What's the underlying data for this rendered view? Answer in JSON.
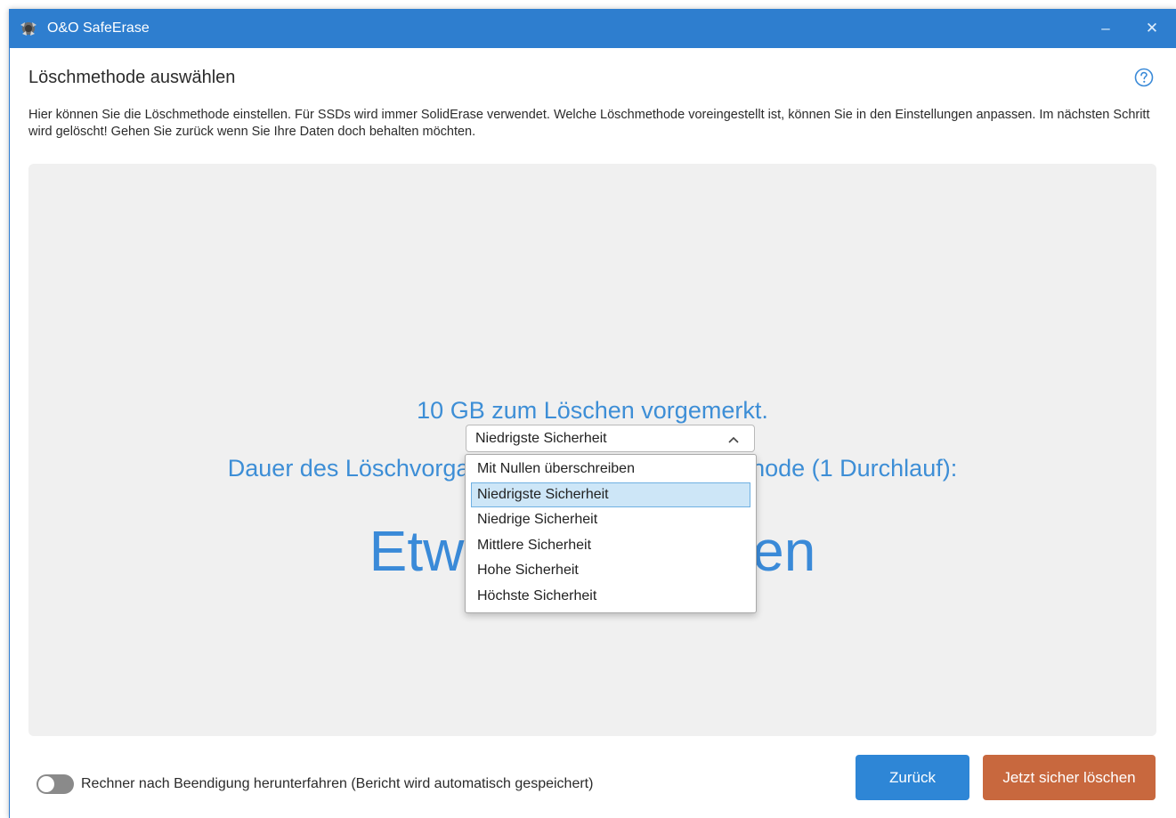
{
  "window": {
    "title": "O&O SafeErase",
    "minimize_glyph": "–",
    "close_glyph": "✕"
  },
  "page": {
    "title": "Löschmethode auswählen",
    "help_icon": "question-circle-icon",
    "description": "Hier können Sie die Löschmethode einstellen. Für SSDs wird immer SolidErase verwendet. Welche Löschmethode voreingestellt ist, können Sie in den Einstellungen anpassen. Im nächsten Schritt wird gelöscht! Gehen Sie zurück wenn Sie Ihre Daten doch behalten möchten."
  },
  "method_select": {
    "selected": "Niedrigste Sicherheit",
    "options": [
      "Mit Nullen überschreiben",
      "Niedrigste Sicherheit",
      "Niedrige Sicherheit",
      "Mittlere Sicherheit",
      "Hohe Sicherheit",
      "Höchste Sicherheit"
    ],
    "highlighted_index": 1
  },
  "summary": {
    "line1": "10 GB zum Löschen vorgemerkt.",
    "line2": "Dauer des Löschvorgangs mit der gewählten Methode (1 Durchlauf):",
    "duration": "Etwa 1 Sekunden"
  },
  "footer": {
    "shutdown_label": "Rechner nach Beendigung herunterfahren (Bericht wird automatisch gespeichert)",
    "shutdown_enabled": false,
    "back_label": "Zurück",
    "erase_label": "Jetzt sicher löschen"
  },
  "colors": {
    "titlebar": "#2e7ecf",
    "accent_text": "#3d8ed6",
    "back_button": "#2e86d6",
    "erase_button": "#c8683e",
    "selection": "#cde6f7"
  }
}
